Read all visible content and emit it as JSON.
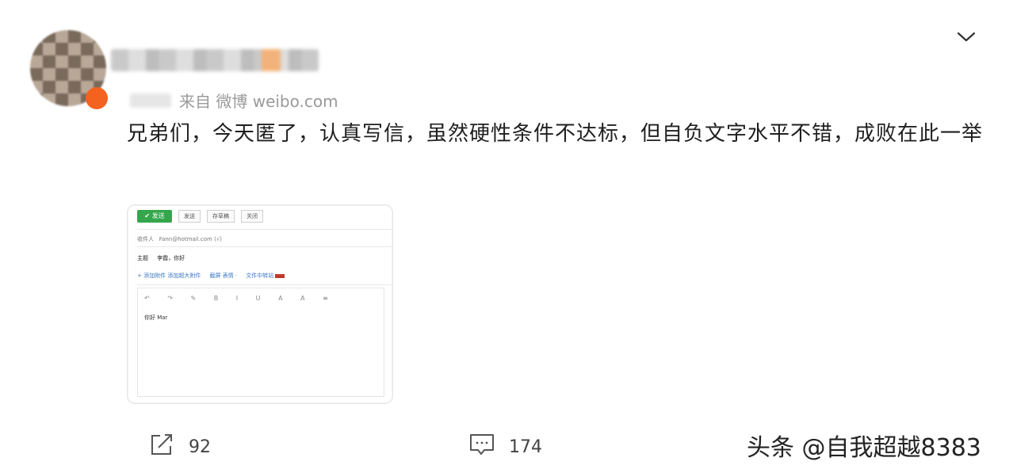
{
  "post": {
    "source_text": "来自 微博 weibo.com",
    "content": "兄弟们，今天匿了，认真写信，虽然硬性条件不达标，但自负文字水平不错，成败在此一举"
  },
  "thumbnail": {
    "send_label": "✔ 发送",
    "toolbar": [
      "发送",
      "存草稿",
      "关闭"
    ],
    "recipient_label": "收件人",
    "recipient_value": "Fann@hotmail.com (√)",
    "subject_label": "主题",
    "subject_value": "李霞，你好",
    "links_left": "+ 添加附件  添加超大附件",
    "links_mid": "截屏 表情 ·",
    "links_right": "文件中转站",
    "editor_icons": "↶ ↷ ✎ B I U A A ≡",
    "editor_body": "你好    Mar"
  },
  "actions": {
    "repost_count": "92",
    "comment_count": "174"
  },
  "watermark": "头条 @自我超越8383"
}
